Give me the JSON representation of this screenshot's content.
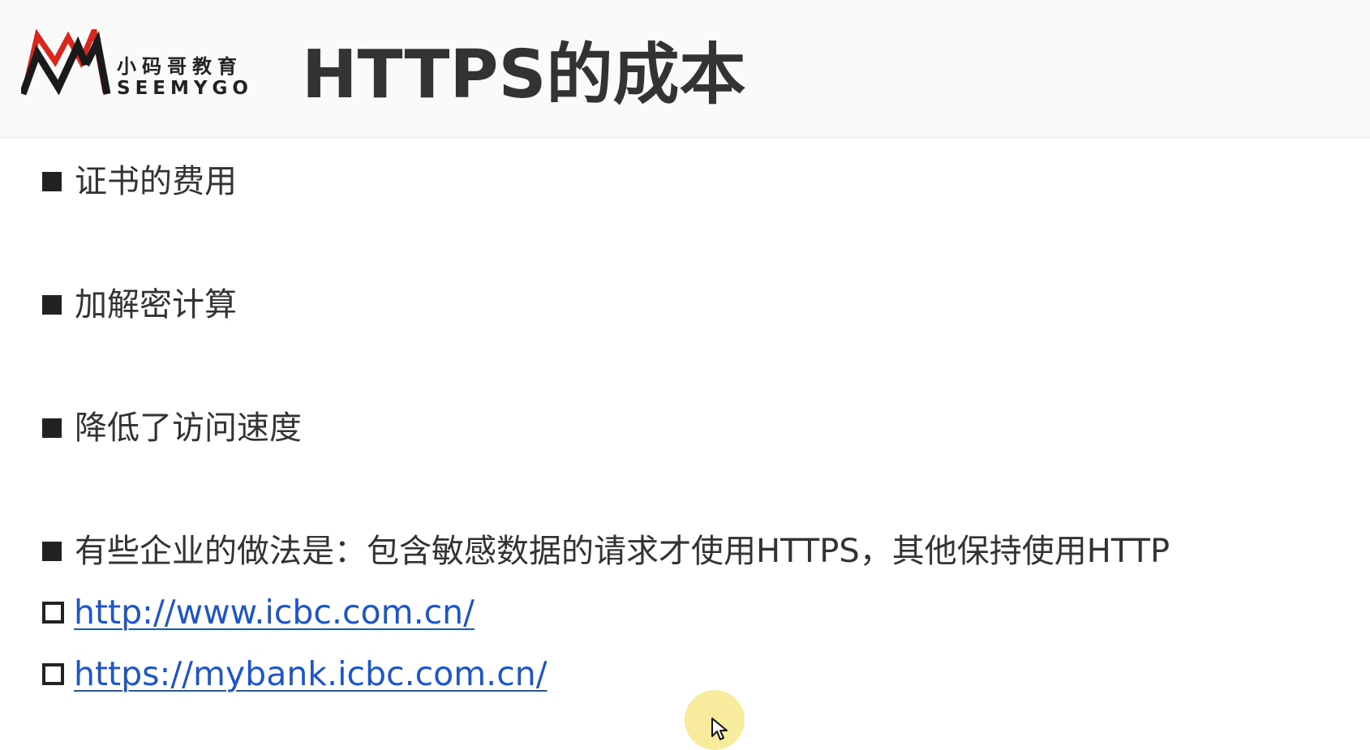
{
  "header": {
    "logo": {
      "chinese_name": "小码哥教育",
      "english_name": "SEEMYGO",
      "colors": {
        "red": "#d7261c",
        "dark": "#1a1a1a"
      }
    },
    "title": "HTTPS的成本"
  },
  "bullets": [
    {
      "text": "证书的费用"
    },
    {
      "text": "加解密计算"
    },
    {
      "text": "降低了访问速度"
    },
    {
      "text": "有些企业的做法是：包含敏感数据的请求才使用HTTPS，其他保持使用HTTP"
    }
  ],
  "links": [
    {
      "text": "http://www.icbc.com.cn/"
    },
    {
      "text": "https://mybank.icbc.com.cn/"
    }
  ],
  "theme": {
    "text_color": "#333333",
    "link_color": "#1f56c7",
    "cursor_highlight": "#f6e88c"
  },
  "icons": {
    "bullet": "filled-square",
    "link_bullet": "hollow-square",
    "cursor": "mouse-pointer-icon"
  }
}
